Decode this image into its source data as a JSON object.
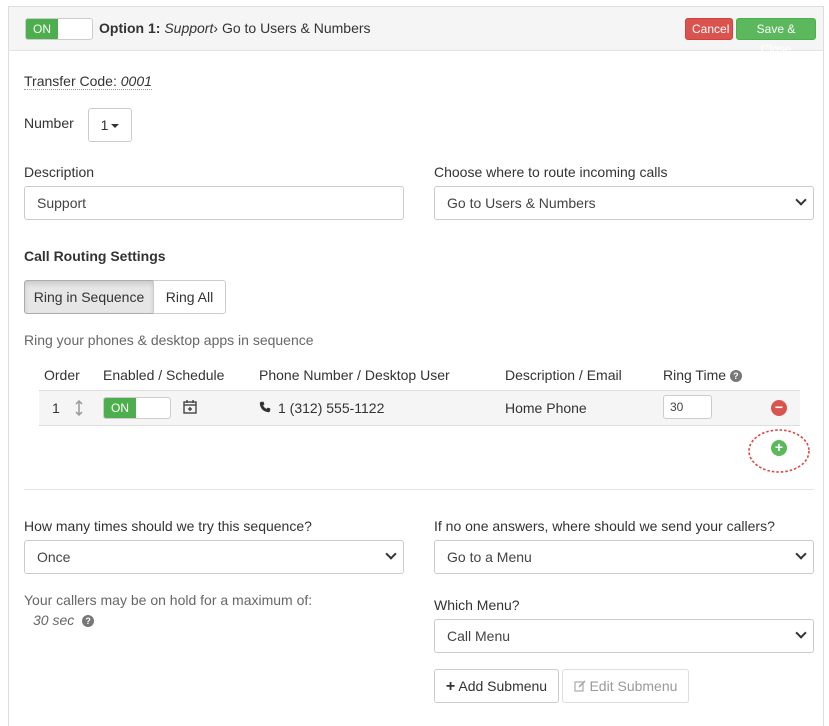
{
  "header": {
    "toggle_label": "ON",
    "option_prefix": "Option 1:",
    "option_name": "Support",
    "arrow": "›",
    "route_target": "Go to Users & Numbers",
    "cancel_label": "Cancel",
    "save_close_label": "Save & Close"
  },
  "form": {
    "transfer_code_label": "Transfer Code:",
    "transfer_code_value": "0001",
    "number_label": "Number",
    "number_value": "1",
    "description_label": "Description",
    "description_value": "Support",
    "route_label": "Choose where to route incoming calls",
    "route_value": "Go to Users & Numbers"
  },
  "routing": {
    "heading": "Call Routing Settings",
    "tab_sequence": "Ring in Sequence",
    "tab_all": "Ring All",
    "hint": "Ring your phones & desktop apps in sequence",
    "columns": {
      "order": "Order",
      "enabled": "Enabled / Schedule",
      "phone": "Phone Number / Desktop User",
      "desc": "Description / Email",
      "ring_time": "Ring Time"
    },
    "rows": [
      {
        "order": "1",
        "enabled_label": "ON",
        "phone": "1 (312) 555-1122",
        "description": "Home Phone",
        "ring_time": "30"
      }
    ]
  },
  "sequence": {
    "tries_label": "How many times should we try this sequence?",
    "tries_value": "Once",
    "no_answer_label": "If no one answers, where should we send your callers?",
    "no_answer_value": "Go to a Menu",
    "hold_label": "Your callers may be on hold for a maximum of:",
    "hold_value": "30 sec",
    "menu_label": "Which Menu?",
    "menu_value": "Call Menu",
    "add_submenu_label": "Add Submenu",
    "edit_submenu_label": "Edit Submenu"
  },
  "colors": {
    "toggle_on": "#4cae4c",
    "cancel": "#d9534f",
    "save": "#5cb85c",
    "remove": "#d9534f",
    "add": "#5cb85c",
    "highlight_circle": "#e0453f"
  }
}
